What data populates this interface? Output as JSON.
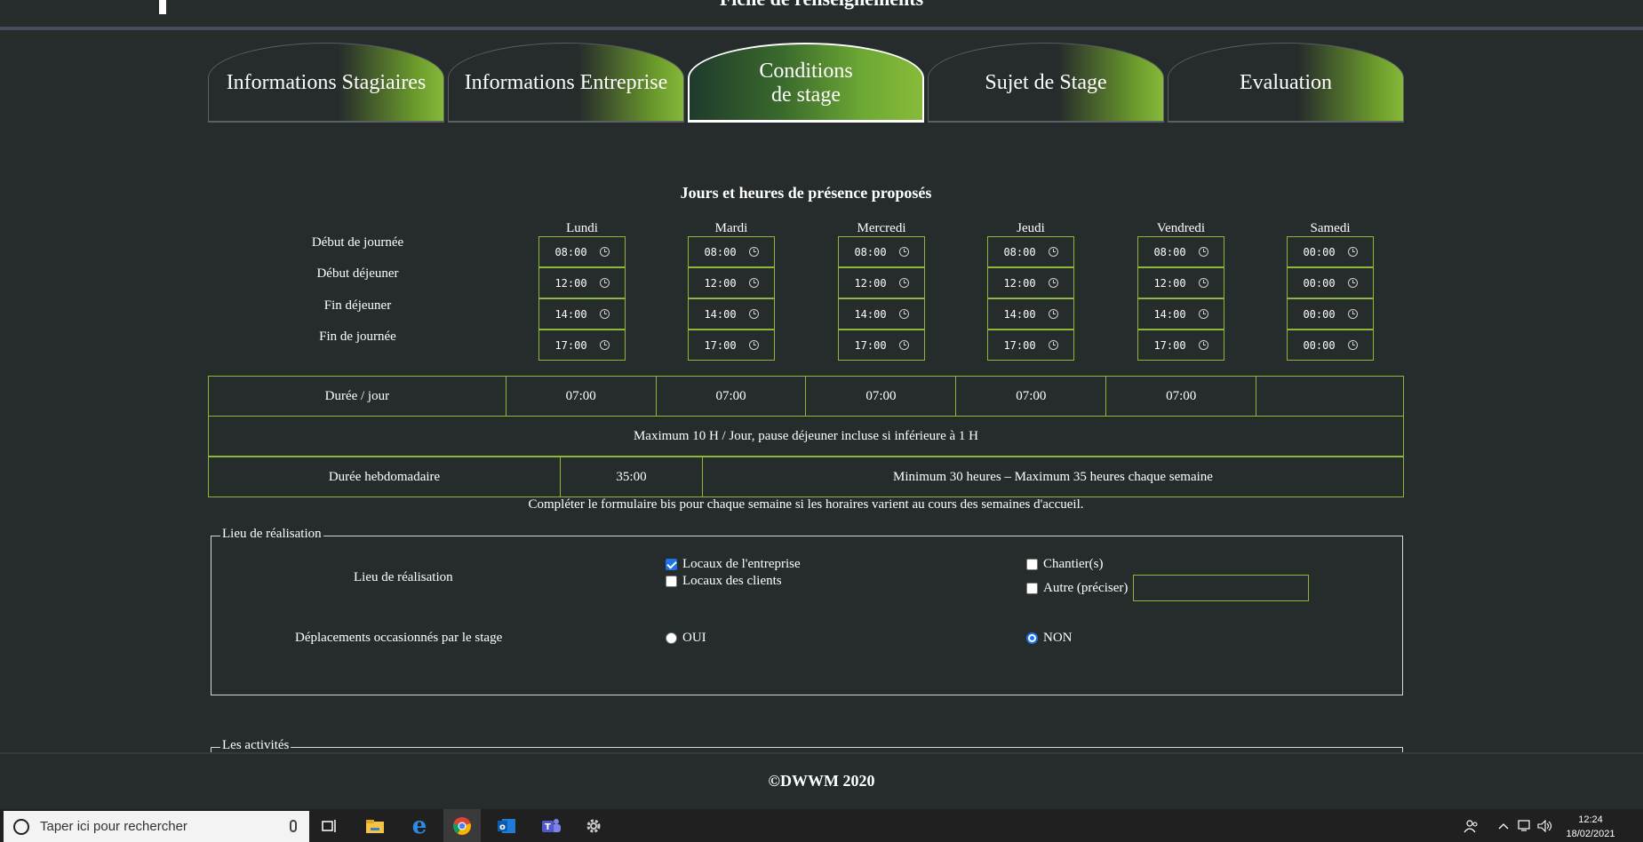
{
  "header": {
    "title": "Fiche de renseignements"
  },
  "tabs": [
    {
      "label": "Informations Stagiaires",
      "active": false
    },
    {
      "label": "Informations Entreprise",
      "active": false
    },
    {
      "label_line1": "Conditions",
      "label_line2": "de stage",
      "active": true
    },
    {
      "label": "Sujet de Stage",
      "active": false
    },
    {
      "label": "Evaluation",
      "active": false
    }
  ],
  "schedule": {
    "title": "Jours et heures de présence proposés",
    "row_labels": [
      "Début de journée",
      "Début déjeuner",
      "Fin déjeuner",
      "Fin de journée"
    ],
    "days": [
      {
        "name": "Lundi",
        "times": [
          "08:00",
          "12:00",
          "14:00",
          "17:00"
        ]
      },
      {
        "name": "Mardi",
        "times": [
          "08:00",
          "12:00",
          "14:00",
          "17:00"
        ]
      },
      {
        "name": "Mercredi",
        "times": [
          "08:00",
          "12:00",
          "14:00",
          "17:00"
        ]
      },
      {
        "name": "Jeudi",
        "times": [
          "08:00",
          "12:00",
          "14:00",
          "17:00"
        ]
      },
      {
        "name": "Vendredi",
        "times": [
          "08:00",
          "12:00",
          "14:00",
          "17:00"
        ]
      },
      {
        "name": "Samedi",
        "times": [
          "00:00",
          "00:00",
          "00:00",
          "00:00"
        ]
      }
    ]
  },
  "duration_table": {
    "label": "Durée / jour",
    "values": [
      "07:00",
      "07:00",
      "07:00",
      "07:00",
      "07:00",
      ""
    ],
    "max_note": "Maximum 10 H / Jour, pause déjeuner incluse si inférieure à 1 H",
    "weekly_label": "Durée hebdomadaire",
    "weekly_value": "35:00",
    "weekly_note": "Minimum 30 heures – Maximum 35 heures chaque semaine"
  },
  "form_note": "Compléter le formulaire bis pour chaque semaine si les horaires varient au cours des semaines d'accueil.",
  "lieu": {
    "legend": "Lieu de réalisation",
    "label": "Lieu de réalisation",
    "options": [
      {
        "label": "Locaux de l'entreprise",
        "checked": true
      },
      {
        "label": "Locaux des clients",
        "checked": false
      },
      {
        "label": "Chantier(s)",
        "checked": false
      },
      {
        "label": "Autre (préciser)",
        "checked": false
      }
    ],
    "deplacements_label": "Déplacements occasionnés par le stage",
    "deplacements": [
      {
        "label": "OUI",
        "checked": false
      },
      {
        "label": "NON",
        "checked": true
      }
    ]
  },
  "activites": {
    "legend": "Les activités"
  },
  "footer": {
    "text": "©DWWM 2020"
  },
  "taskbar": {
    "search_placeholder": "Taper ici pour rechercher",
    "time": "12:24",
    "date": "18/02/2021",
    "icons": [
      "task-view-icon",
      "file-explorer-icon",
      "edge-icon",
      "chrome-icon",
      "outlook-icon",
      "teams-icon",
      "settings-icon"
    ]
  },
  "colors": {
    "background": "#262b2b",
    "accent_green": "#8db83a",
    "tab_green": "#86b839"
  }
}
